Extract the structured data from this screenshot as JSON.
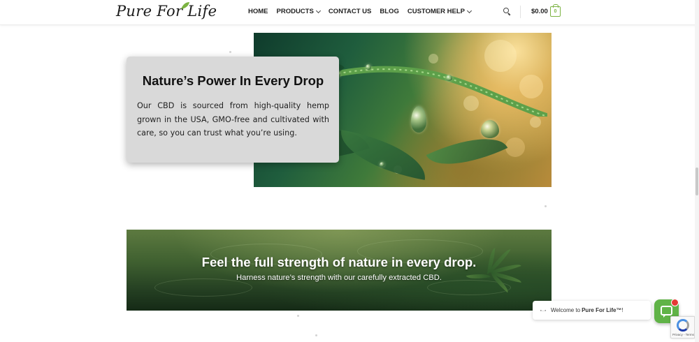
{
  "header": {
    "logo_text": "Pure For Life",
    "nav": [
      {
        "label": "HOME",
        "dropdown": false
      },
      {
        "label": "PRODUCTS",
        "dropdown": true
      },
      {
        "label": "CONTACT US",
        "dropdown": false
      },
      {
        "label": "BLOG",
        "dropdown": false
      },
      {
        "label": "CUSTOMER HELP",
        "dropdown": true
      }
    ],
    "cart_total": "$0.00",
    "cart_count": "0",
    "icons": [
      "search-icon",
      "shopping-bag-icon",
      "chevron-down-icon"
    ],
    "accent_color": "#7cb342"
  },
  "hero": {
    "title": "Nature’s Power In Every Drop",
    "text": "Our CBD is sourced from high-quality hemp grown in the USA, GMO-free and cultivated with care, so you can trust what you’re using."
  },
  "banner": {
    "title": "Feel the full strength of nature in every drop.",
    "subtitle": "Harness nature’s strength with our carefully extracted CBD."
  },
  "chat": {
    "welcome_prefix": "Welcome to ",
    "welcome_brand": "Pure For Life™",
    "welcome_suffix": "!",
    "icons": [
      "chat-icon",
      "notification-badge-icon"
    ],
    "button_color": "#60b347",
    "badge_color": "#e53935"
  },
  "recaptcha": {
    "text": "Privacy - Terms"
  }
}
